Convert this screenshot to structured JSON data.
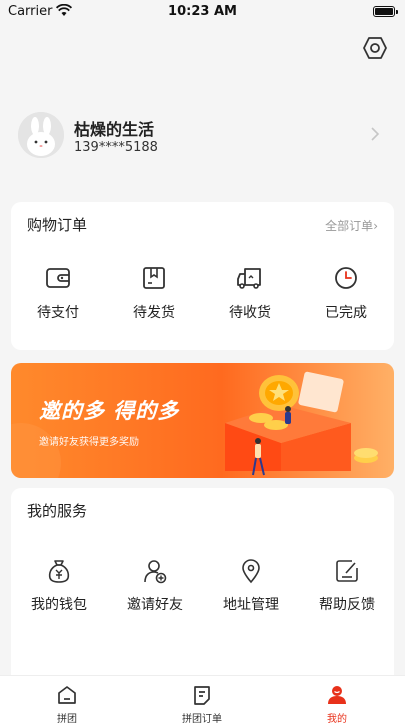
{
  "status_bar": {
    "carrier": "Carrier",
    "time": "10:23 AM"
  },
  "profile": {
    "name": "枯燥的生活",
    "phone": "139****5188"
  },
  "orders": {
    "title": "购物订单",
    "more": "全部订单",
    "items": [
      {
        "label": "待支付",
        "icon": "wallet-icon"
      },
      {
        "label": "待发货",
        "icon": "package-icon"
      },
      {
        "label": "待收货",
        "icon": "truck-icon"
      },
      {
        "label": "已完成",
        "icon": "clock-icon"
      }
    ]
  },
  "banner": {
    "title": "邀的多 得的多",
    "subtitle": "邀请好友获得更多奖励"
  },
  "services": {
    "title": "我的服务",
    "items": [
      {
        "label": "我的钱包",
        "icon": "money-bag-icon"
      },
      {
        "label": "邀请好友",
        "icon": "add-user-icon"
      },
      {
        "label": "地址管理",
        "icon": "location-pin-icon"
      },
      {
        "label": "帮助反馈",
        "icon": "feedback-icon"
      }
    ]
  },
  "tabbar": {
    "items": [
      {
        "label": "拼团",
        "icon": "home-icon"
      },
      {
        "label": "拼团订单",
        "icon": "order-list-icon"
      },
      {
        "label": "我的",
        "icon": "user-icon"
      }
    ],
    "active": "我的"
  },
  "colors": {
    "accent": "#e8311a",
    "banner_start": "#ff8a2c",
    "banner_end": "#ffb066"
  }
}
